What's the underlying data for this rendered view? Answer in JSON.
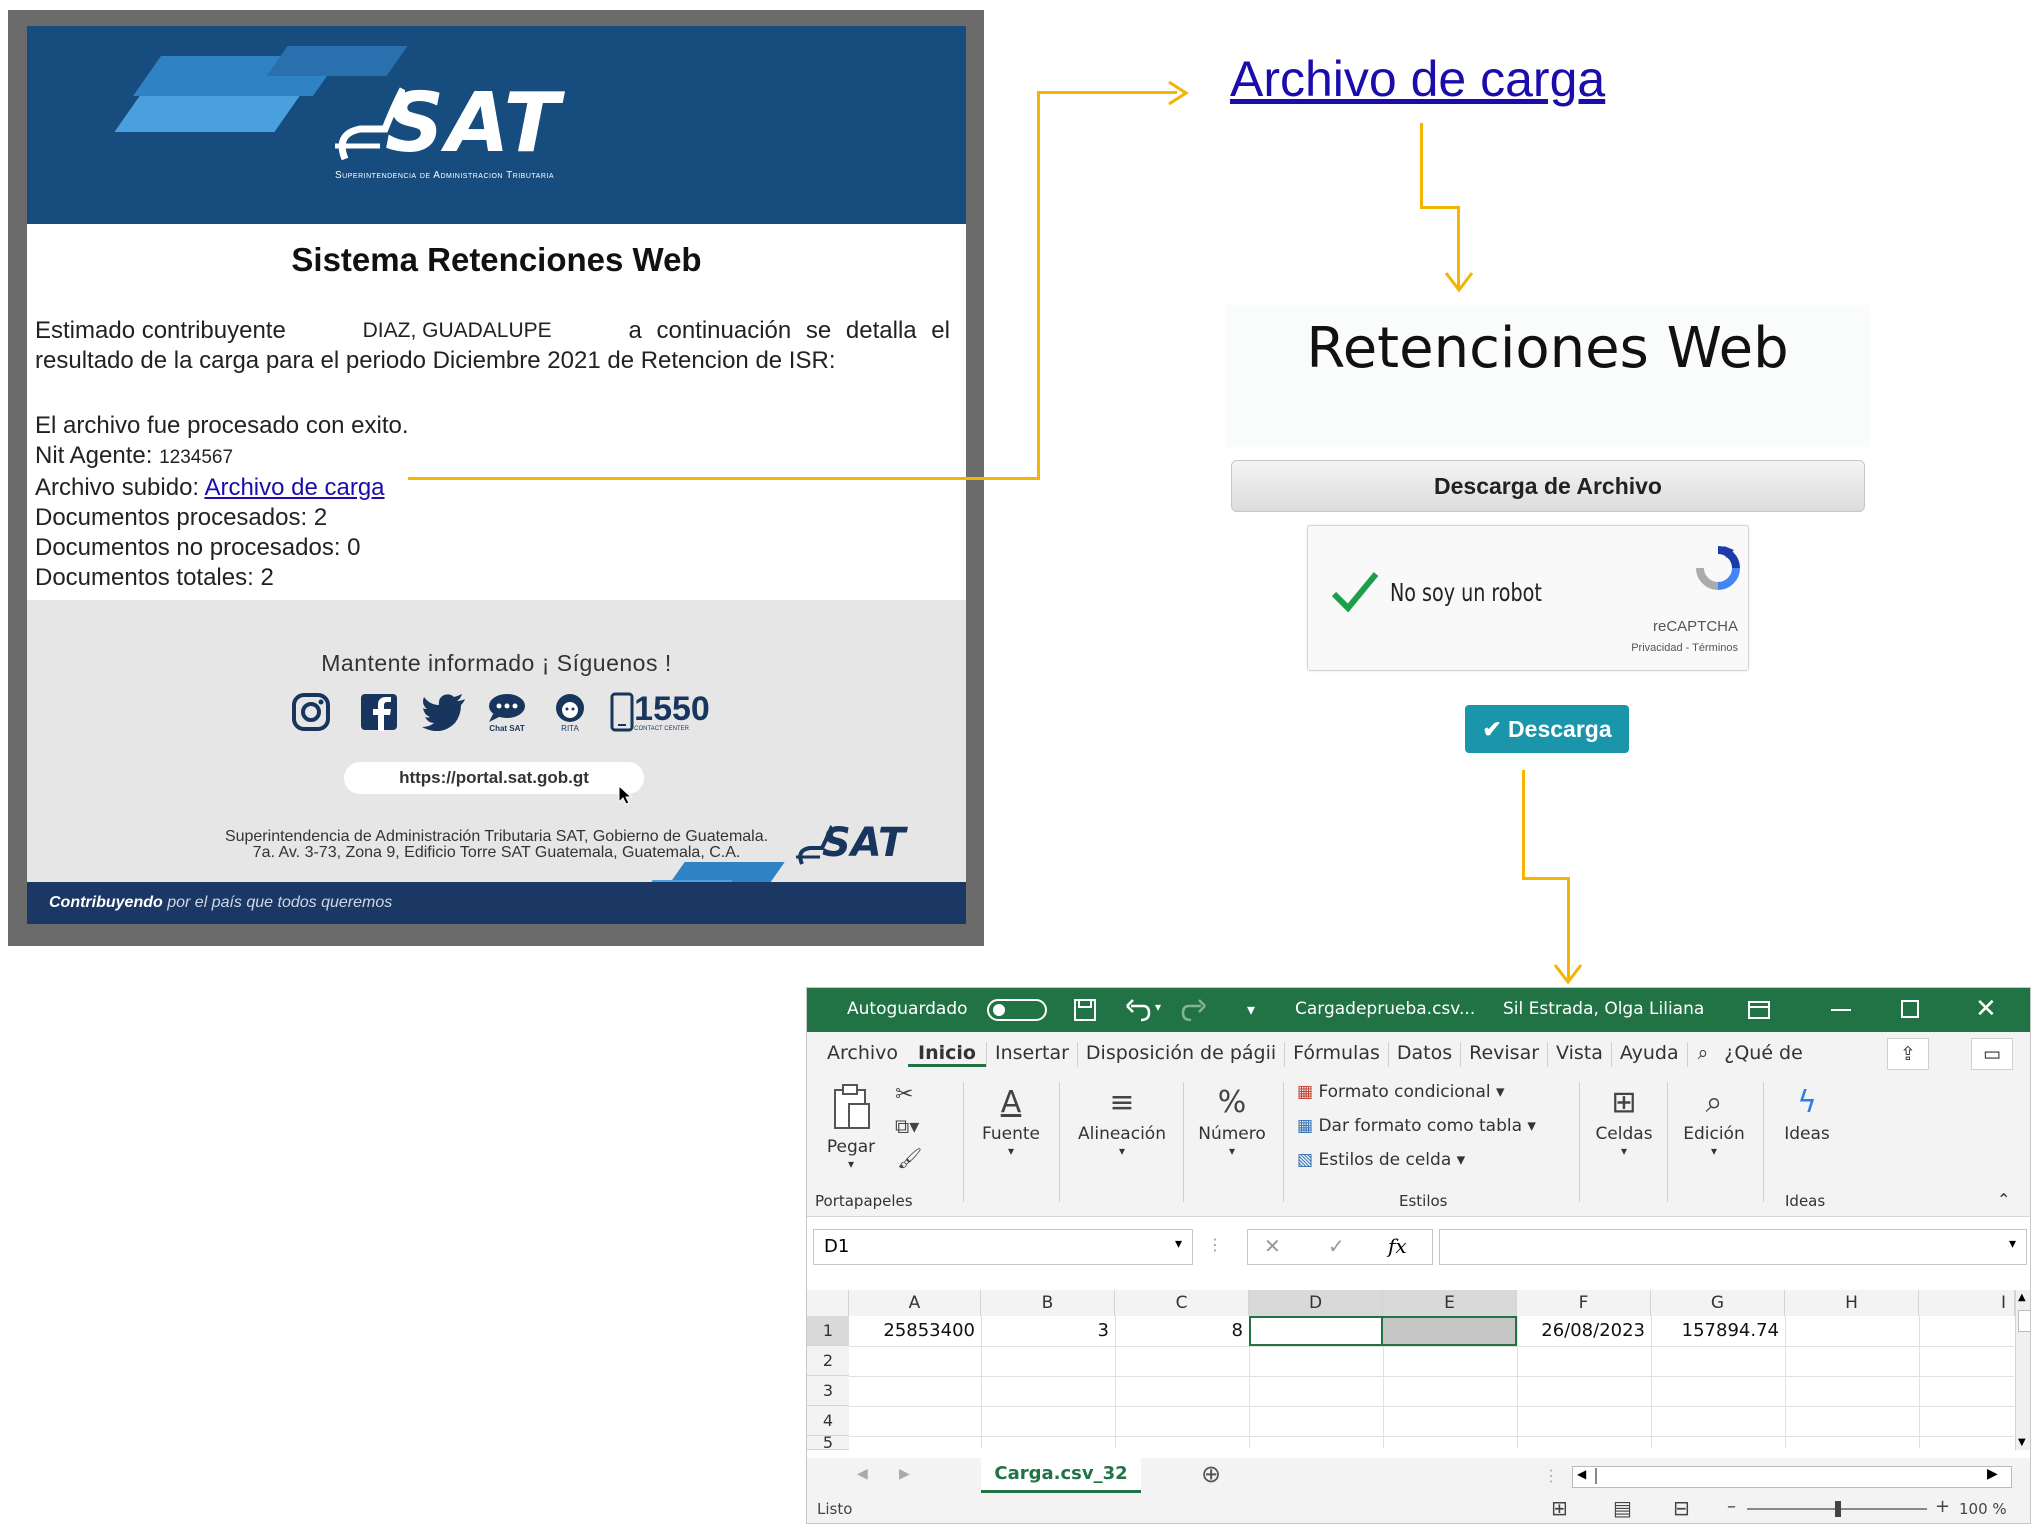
{
  "email": {
    "logo_text": "SAT",
    "logo_subtitle": "Superintendencia de Administracion Tributaria",
    "title": "Sistema Retenciones Web",
    "greeting_prefix": "Estimado contribuyente",
    "contributor_name": "DIAZ, GUADALUPE",
    "greeting_suffix": "a continuación se detalla el",
    "line2": "resultado de la carga para el periodo Diciembre 2021 de Retencion de ISR:",
    "processed_msg": "El archivo fue procesado con exito.",
    "nit_label": "Nit Agente:",
    "nit_value": "1234567",
    "file_label": "Archivo subido:",
    "file_link": "Archivo de carga",
    "docs_processed": "Documentos procesados: 2",
    "docs_not_processed": "Documentos no procesados: 0",
    "docs_total": "Documentos totales: 2",
    "footer_follow": "Mantente informado ¡ Síguenos !",
    "chat_label": "Chat SAT",
    "rita_label": "RITA",
    "contact_number": "1550",
    "contact_label": "CONTACT CENTER",
    "portal_url": "https://portal.sat.gob.gt",
    "address_line1": "Superintendencia de Administración Tributaria SAT, Gobierno de Guatemala.",
    "address_line2": "7a. Av. 3-73, Zona 9, Edificio Torre SAT Guatemala, Guatemala, C.A.",
    "tagline_bold": "Contribuyendo",
    "tagline_rest": "por el país que todos queremos"
  },
  "link_heading": "Archivo de carga",
  "retenciones": {
    "title": "Retenciones Web",
    "header": "Descarga de Archivo",
    "captcha_label": "No soy un robot",
    "captcha_brand": "reCAPTCHA",
    "captcha_links": "Privacidad - Términos",
    "download_button": "✔ Descarga"
  },
  "excel": {
    "autosave_label": "Autoguardado",
    "filename": "Cargadeprueba.csv...",
    "user": "Sil Estrada, Olga Liliana",
    "tabs": [
      "Archivo",
      "Inicio",
      "Insertar",
      "Disposición de págii",
      "Fórmulas",
      "Datos",
      "Revisar",
      "Vista",
      "Ayuda",
      "¿Qué de"
    ],
    "active_tab": "Inicio",
    "ribbon": {
      "paste": "Pegar",
      "clipboard_group": "Portapapeles",
      "font": "Fuente",
      "alignment": "Alineación",
      "number": "Número",
      "cond_format": "Formato condicional",
      "table_format": "Dar formato como tabla",
      "cell_styles": "Estilos de celda",
      "styles_group": "Estilos",
      "cells": "Celdas",
      "editing": "Edición",
      "ideas": "Ideas",
      "ideas_group": "Ideas"
    },
    "name_box": "D1",
    "fx_label": "fx",
    "columns": [
      "A",
      "B",
      "C",
      "D",
      "E",
      "F",
      "G",
      "H",
      "I"
    ],
    "rows": [
      "1",
      "2",
      "3",
      "4",
      "5"
    ],
    "row1": {
      "A": "25853400",
      "B": "3",
      "C": "8",
      "D": "",
      "E": "",
      "F": "26/08/2023",
      "G": "157894.74",
      "H": ""
    },
    "sheet_tab": "Carga.csv_32",
    "status": "Listo",
    "zoom": "100 %"
  }
}
